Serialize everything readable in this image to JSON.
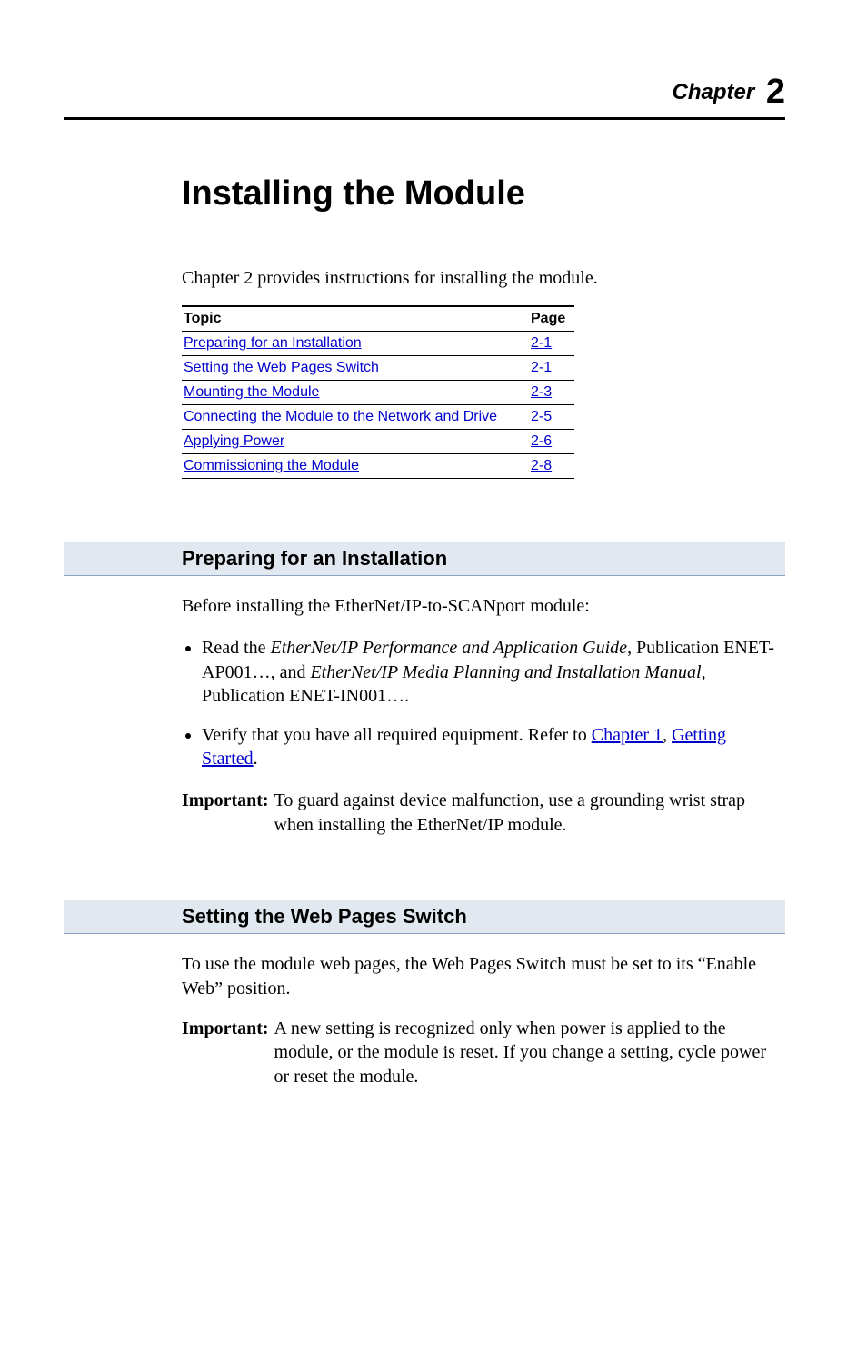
{
  "chapter": {
    "label_word": "Chapter",
    "number": "2"
  },
  "title": "Installing the Module",
  "intro": "Chapter 2 provides instructions for installing the module.",
  "toc": {
    "headers": {
      "topic": "Topic",
      "page": "Page"
    },
    "rows": [
      {
        "topic": "Preparing for an Installation",
        "page": "2-1"
      },
      {
        "topic": "Setting the Web Pages Switch",
        "page": "2-1"
      },
      {
        "topic": "Mounting the Module",
        "page": "2-3"
      },
      {
        "topic": "Connecting the Module to the Network and Drive",
        "page": "2-5"
      },
      {
        "topic": "Applying Power",
        "page": "2-6"
      },
      {
        "topic": "Commissioning the Module",
        "page": "2-8"
      }
    ]
  },
  "section1": {
    "heading": "Preparing for an Installation",
    "intro": "Before installing the EtherNet/IP-to-SCANport module:",
    "bullet1_pre": "Read the ",
    "bullet1_em1": "EtherNet/IP Performance and Application Guide",
    "bullet1_mid": ", Publication ENET-AP001…, and ",
    "bullet1_em2": "EtherNet/IP Media Planning and Installation Manual",
    "bullet1_post": ", Publication ENET-IN001….",
    "bullet2_pre": "Verify that you have all required equipment. Refer to ",
    "bullet2_link1": "Chapter 1",
    "bullet2_mid": ", ",
    "bullet2_link2": "Getting Started",
    "bullet2_post": ".",
    "important_label": "Important:",
    "important_text": "To guard against device malfunction, use a grounding wrist strap when installing the EtherNet/IP module."
  },
  "section2": {
    "heading": "Setting the Web Pages Switch",
    "para": "To use the module web pages, the Web Pages Switch must be set to its “Enable Web” position.",
    "important_label": "Important:",
    "important_text": "A new setting is recognized only when power is applied to the module, or the module is reset. If you change a setting, cycle power or reset the module."
  }
}
